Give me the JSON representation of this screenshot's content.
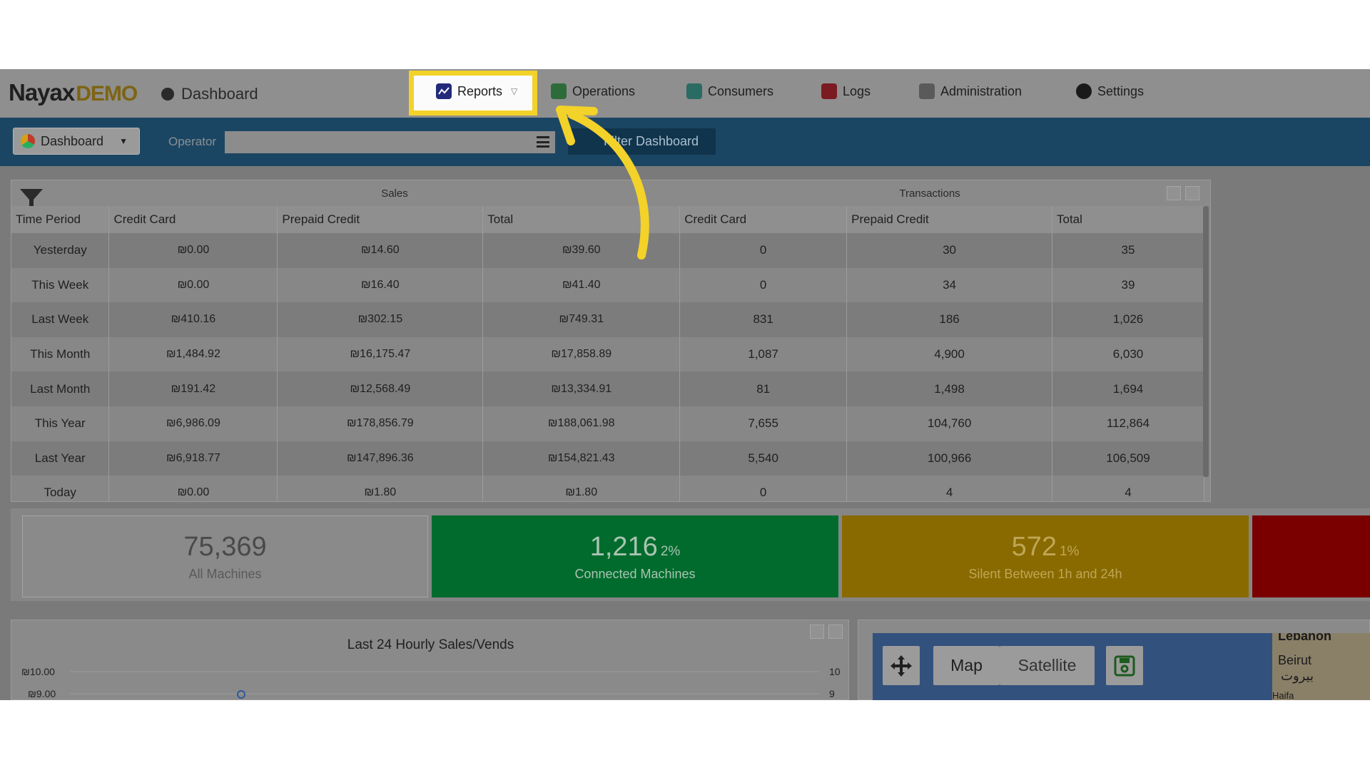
{
  "header": {
    "logo_main": "Nayax",
    "logo_suffix": "DEMO",
    "breadcrumb": "Dashboard"
  },
  "nav": {
    "reports": "Reports",
    "operations": "Operations",
    "consumers": "Consumers",
    "logs": "Logs",
    "administration": "Administration",
    "settings": "Settings"
  },
  "filterbar": {
    "dashboard_select": "Dashboard",
    "operator_label": "Operator",
    "operator_value": "",
    "filter_button": "Filter Dashboard"
  },
  "summary_table": {
    "group_sales": "Sales",
    "group_transactions": "Transactions",
    "headers": [
      "Time Period",
      "Credit Card",
      "Prepaid Credit",
      "Total",
      "Credit Card",
      "Prepaid Credit",
      "Total"
    ],
    "rows": [
      [
        "Yesterday",
        "₪0.00",
        "₪14.60",
        "₪39.60",
        "0",
        "30",
        "35"
      ],
      [
        "This Week",
        "₪0.00",
        "₪16.40",
        "₪41.40",
        "0",
        "34",
        "39"
      ],
      [
        "Last Week",
        "₪410.16",
        "₪302.15",
        "₪749.31",
        "831",
        "186",
        "1,026"
      ],
      [
        "This Month",
        "₪1,484.92",
        "₪16,175.47",
        "₪17,858.89",
        "1,087",
        "4,900",
        "6,030"
      ],
      [
        "Last Month",
        "₪191.42",
        "₪12,568.49",
        "₪13,334.91",
        "81",
        "1,498",
        "1,694"
      ],
      [
        "This Year",
        "₪6,986.09",
        "₪178,856.79",
        "₪188,061.98",
        "7,655",
        "104,760",
        "112,864"
      ],
      [
        "Last Year",
        "₪6,918.77",
        "₪147,896.36",
        "₪154,821.43",
        "5,540",
        "100,966",
        "106,509"
      ],
      [
        "Today",
        "₪0.00",
        "₪1.80",
        "₪1.80",
        "0",
        "4",
        "4"
      ]
    ]
  },
  "tiles": {
    "all_machines": {
      "value": "75,369",
      "label": "All Machines"
    },
    "connected": {
      "value": "1,216",
      "pct": "2%",
      "label": "Connected Machines"
    },
    "silent": {
      "value": "572",
      "pct": "1%",
      "label": "Silent Between 1h and 24h"
    }
  },
  "hourly_chart": {
    "title": "Last 24 Hourly Sales/Vends",
    "left_ticks": [
      "₪10.00",
      "₪9.00"
    ],
    "right_ticks": [
      "10",
      "9"
    ]
  },
  "map": {
    "map_button": "Map",
    "satellite_button": "Satellite",
    "place_country": "Lebanon",
    "place_city": "Beirut",
    "place_city_ar": "بيروت",
    "place_other": "Haifa"
  },
  "colors": {
    "annotation": "#f3d22a",
    "connected": "#006b2d",
    "silent": "#886a00",
    "offline": "#7a0000",
    "filter_bar": "#1b4663"
  }
}
